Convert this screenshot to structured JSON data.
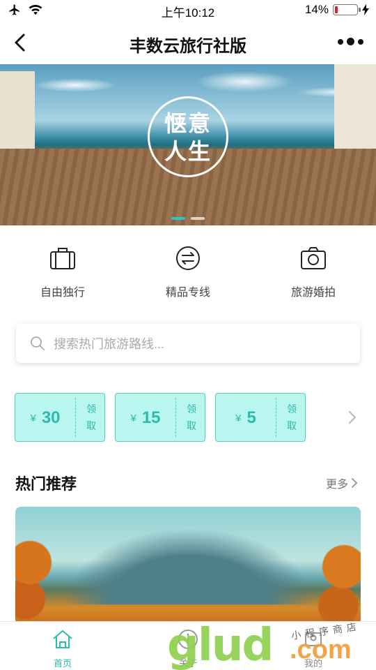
{
  "status_bar": {
    "time": "上午10:12",
    "battery": "14%",
    "battery_level": 0.14
  },
  "nav": {
    "title": "丰数云旅行社版"
  },
  "banner": {
    "logo_line1": "惬意",
    "logo_line2": "人生",
    "slide_count": 2,
    "active_slide": 1
  },
  "categories": [
    {
      "label": "自由独行",
      "icon": "suitcase-icon"
    },
    {
      "label": "精品专线",
      "icon": "exchange-icon"
    },
    {
      "label": "旅游婚拍",
      "icon": "camera-icon"
    }
  ],
  "search": {
    "placeholder": "搜索热门旅游路线..."
  },
  "coupons": [
    {
      "currency": "¥",
      "value": "30",
      "action": "领取"
    },
    {
      "currency": "¥",
      "value": "15",
      "action": "领取"
    },
    {
      "currency": "¥",
      "value": "5",
      "action": "领取"
    }
  ],
  "hot": {
    "title": "热门推荐",
    "more": "更多"
  },
  "tabbar": [
    {
      "label": "首页",
      "icon": "home-icon",
      "active": true
    },
    {
      "label": "关于",
      "icon": "info-icon",
      "active": false
    },
    {
      "label": "我的",
      "icon": "user-icon",
      "active": false
    }
  ],
  "watermark": {
    "brand": "glud",
    "domain": ".com",
    "small": "小程序商店"
  },
  "colors": {
    "accent": "#2cb9ae",
    "coupon_bg": "#b9f6f0",
    "coupon_border": "#4dcfc6"
  }
}
